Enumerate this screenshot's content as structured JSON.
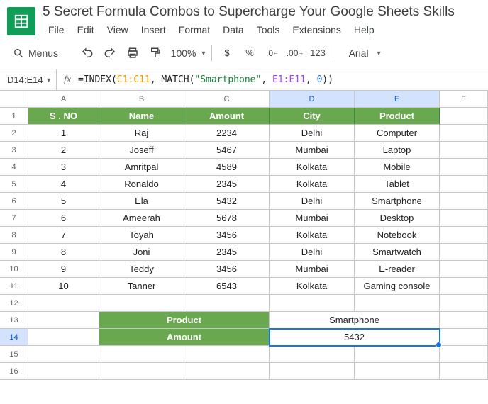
{
  "app": {
    "title": "5 Secret Formula Combos to Supercharge Your Google Sheets Skills"
  },
  "menu": {
    "file": "File",
    "edit": "Edit",
    "view": "View",
    "insert": "Insert",
    "format": "Format",
    "data": "Data",
    "tools": "Tools",
    "extensions": "Extensions",
    "help": "Help"
  },
  "toolbar": {
    "menus": "Menus",
    "zoom": "100%",
    "font": "Arial",
    "numfmt": "123"
  },
  "formula": {
    "cellref": "D14:E14",
    "prefix": "=",
    "f_index": "INDEX",
    "rng_c": "C1:C11",
    "f_match": "MATCH",
    "str": "\"Smartphone\"",
    "rng_e": "E1:E11",
    "zero": "0"
  },
  "columns": [
    "A",
    "B",
    "C",
    "D",
    "E",
    "F"
  ],
  "rows": [
    "1",
    "2",
    "3",
    "4",
    "5",
    "6",
    "7",
    "8",
    "9",
    "10",
    "11",
    "12",
    "13",
    "14",
    "15",
    "16"
  ],
  "headers": {
    "a": "S . NO",
    "b": "Name",
    "c": "Amount",
    "d": "City",
    "e": "Product"
  },
  "table": [
    {
      "sno": "1",
      "name": "Raj",
      "amount": "2234",
      "city": "Delhi",
      "product": "Computer"
    },
    {
      "sno": "2",
      "name": "Joseff",
      "amount": "5467",
      "city": "Mumbai",
      "product": "Laptop"
    },
    {
      "sno": "3",
      "name": "Amritpal",
      "amount": "4589",
      "city": "Kolkata",
      "product": "Mobile"
    },
    {
      "sno": "4",
      "name": "Ronaldo",
      "amount": "2345",
      "city": "Kolkata",
      "product": "Tablet"
    },
    {
      "sno": "5",
      "name": "Ela",
      "amount": "5432",
      "city": "Delhi",
      "product": "Smartphone"
    },
    {
      "sno": "6",
      "name": "Ameerah",
      "amount": "5678",
      "city": "Mumbai",
      "product": "Desktop"
    },
    {
      "sno": "7",
      "name": "Toyah",
      "amount": "3456",
      "city": "Kolkata",
      "product": "Notebook"
    },
    {
      "sno": "8",
      "name": "Joni",
      "amount": "2345",
      "city": "Delhi",
      "product": "Smartwatch"
    },
    {
      "sno": "9",
      "name": "Teddy",
      "amount": "3456",
      "city": "Mumbai",
      "product": "E-reader"
    },
    {
      "sno": "10",
      "name": "Tanner",
      "amount": "6543",
      "city": "Kolkata",
      "product": "Gaming console"
    }
  ],
  "lookup": {
    "product_label": "Product",
    "product_value": "Smartphone",
    "amount_label": "Amount",
    "amount_value": "5432"
  }
}
